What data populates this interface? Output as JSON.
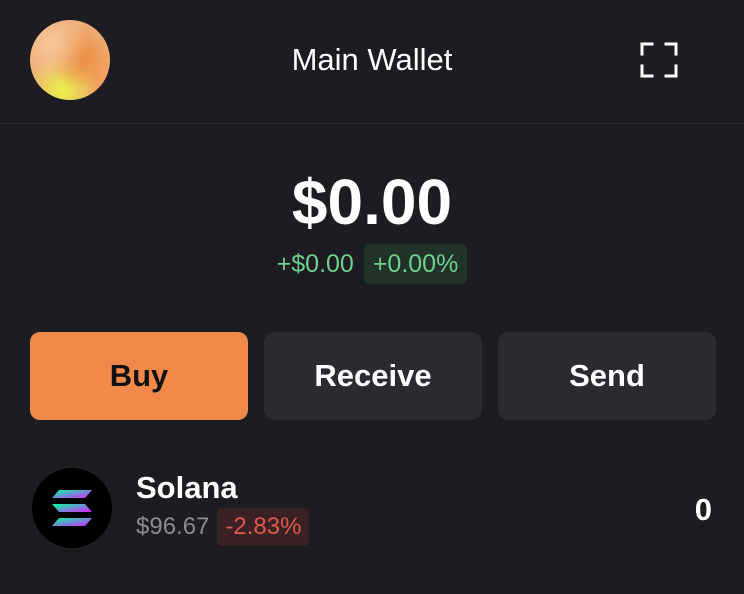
{
  "header": {
    "title": "Main Wallet",
    "avatar_icon": "gradient-avatar",
    "expand_icon": "expand-icon"
  },
  "balance": {
    "total": "$0.00",
    "change_amount": "+$0.00",
    "change_percent": "+0.00%"
  },
  "actions": {
    "buy_label": "Buy",
    "receive_label": "Receive",
    "send_label": "Send"
  },
  "tokens": [
    {
      "name": "Solana",
      "price": "$96.67",
      "change": "-2.83%",
      "balance": "0",
      "icon": "solana-logo-icon"
    }
  ],
  "colors": {
    "background": "#1c1c21",
    "accent": "#f0894a",
    "positive": "#6fcf8f",
    "negative": "#e0574e",
    "button_secondary": "#2a2a30"
  }
}
